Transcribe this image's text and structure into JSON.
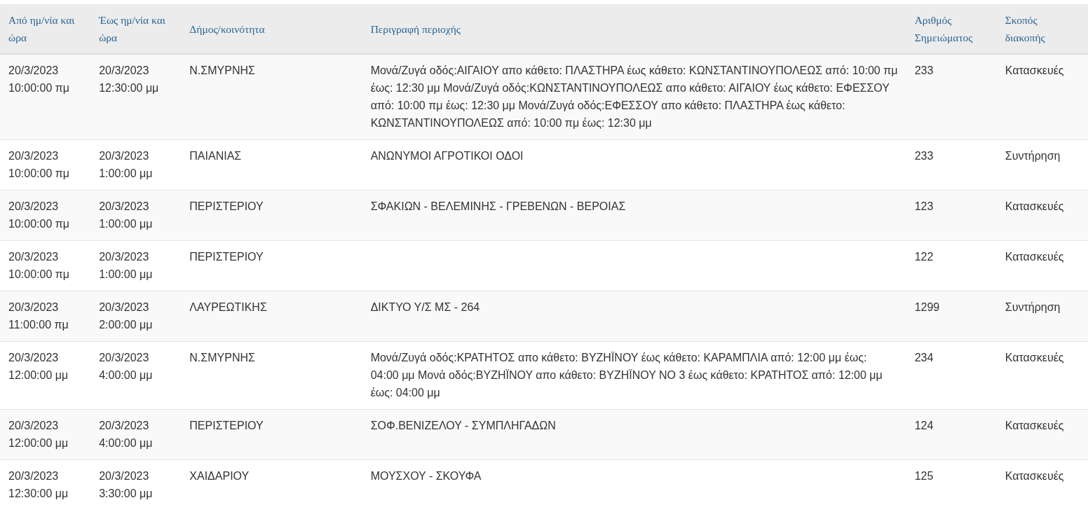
{
  "table": {
    "columns": [
      "Από ημ/νία και ώρα",
      "Έως ημ/νία και ώρα",
      "Δήμος/κοινότητα",
      "Περιγραφή περιοχής",
      "Αριθμός Σημειώματος",
      "Σκοπός διακοπής"
    ],
    "rows": [
      {
        "cells": [
          "20/3/2023 10:00:00 πμ",
          "20/3/2023 12:30:00 μμ",
          "Ν.ΣΜΥΡΝΗΣ",
          "Μονά/Ζυγά οδός:ΑΙΓΑΙΟΥ απο κάθετο: ΠΛΑΣΤΗΡΑ έως κάθετο: ΚΩΝΣΤΑΝΤΙΝΟΥΠΟΛΕΩΣ από: 10:00 πμ έως: 12:30 μμ Μονά/Ζυγά οδός:ΚΩΝΣΤΑΝΤΙΝΟΥΠΟΛΕΩΣ απο κάθετο: ΑΙΓΑΙΟΥ έως κάθετο: ΕΦΕΣΣΟΥ από: 10:00 πμ έως: 12:30 μμ Μονά/Ζυγά οδός:ΕΦΕΣΣΟΥ απο κάθετο: ΠΛΑΣΤΗΡΑ έως κάθετο: ΚΩΝΣΤΑΝΤΙΝΟΥΠΟΛΕΩΣ από: 10:00 πμ έως: 12:30 μμ",
          "233",
          "Κατασκευές"
        ]
      },
      {
        "cells": [
          "20/3/2023 10:00:00 πμ",
          "20/3/2023 1:00:00 μμ",
          "ΠΑΙΑΝΙΑΣ",
          "ΑΝΩΝΥΜΟΙ ΑΓΡΟΤΙΚΟΙ ΟΔΟΙ",
          "233",
          "Συντήρηση"
        ]
      },
      {
        "cells": [
          "20/3/2023 10:00:00 πμ",
          "20/3/2023 1:00:00 μμ",
          "ΠΕΡΙΣΤΕΡΙΟΥ",
          "ΣΦΑΚΙΩΝ - ΒΕΛΕΜΙΝΗΣ - ΓΡΕΒΕΝΩΝ - ΒΕΡΟΙΑΣ",
          "123",
          "Κατασκευές"
        ]
      },
      {
        "cells": [
          "20/3/2023 10:00:00 πμ",
          "20/3/2023 1:00:00 μμ",
          "ΠΕΡΙΣΤΕΡΙΟΥ",
          null,
          "122",
          "Κατασκευές"
        ]
      },
      {
        "cells": [
          "20/3/2023 11:00:00 πμ",
          "20/3/2023 2:00:00 μμ",
          "ΛΑΥΡΕΩΤΙΚΗΣ",
          "ΔΙΚΤΥΟ Υ/Σ ΜΣ - 264",
          "1299",
          "Συντήρηση"
        ]
      },
      {
        "cells": [
          "20/3/2023 12:00:00 μμ",
          "20/3/2023 4:00:00 μμ",
          "Ν.ΣΜΥΡΝΗΣ",
          "Μονά/Ζυγά οδός:ΚΡΑΤΗΤΟΣ απο κάθετο: ΒΥΖΗΪΝΟΥ έως κάθετο: ΚΑΡΑΜΠΛΙΑ από: 12:00 μμ έως: 04:00 μμ Μονά οδός:ΒΥΖΗΪΝΟΥ απο κάθετο: ΒΥΖΗΪΝΟΥ ΝΟ 3 έως κάθετο: ΚΡΑΤΗΤΟΣ από: 12:00 μμ έως: 04:00 μμ",
          "234",
          "Κατασκευές"
        ]
      },
      {
        "cells": [
          "20/3/2023 12:00:00 μμ",
          "20/3/2023 4:00:00 μμ",
          "ΠΕΡΙΣΤΕΡΙΟΥ",
          "ΣΟΦ.ΒΕΝΙΖΕΛΟΥ - ΣΥΜΠΛΗΓΑΔΩΝ",
          "124",
          "Κατασκευές"
        ]
      },
      {
        "cells": [
          "20/3/2023 12:30:00 μμ",
          "20/3/2023 3:30:00 μμ",
          "ΧΑΙΔΑΡΙΟΥ",
          "ΜΟΥΣΧΟΥ - ΣΚΟΥΦΑ",
          "125",
          "Κατασκευές"
        ]
      }
    ]
  }
}
